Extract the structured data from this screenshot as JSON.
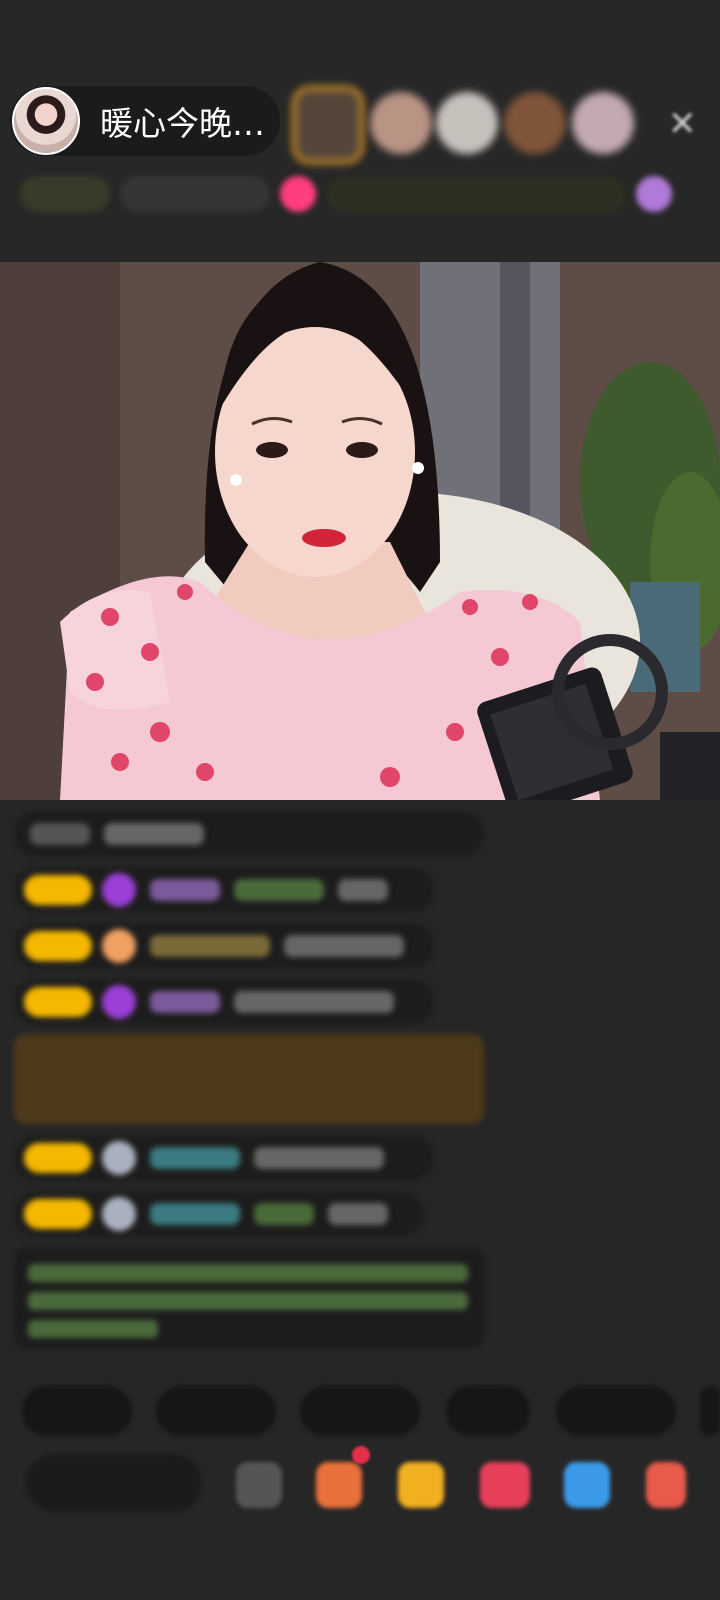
{
  "header": {
    "anchor_name": "暖心今晚…",
    "close_glyph": "✕"
  },
  "colors": {
    "badge": "#f5b800",
    "accent_pink": "#ff3d7f",
    "accent_green": "#b7e24a",
    "system_msg": "#4d3a1a"
  }
}
